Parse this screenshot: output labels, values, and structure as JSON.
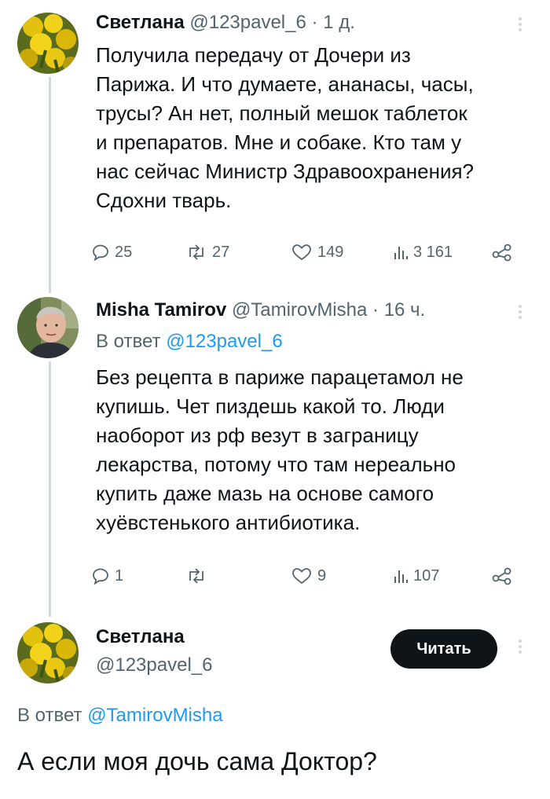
{
  "tweet1": {
    "author_name": "Светлана",
    "handle": "@123pavel_6",
    "separator": "·",
    "time": "1 д.",
    "text": "Получила передачу от Дочери из\nПарижа. И что думаете, ананасы, часы,\nтрусы? Ан нет, полный мешок таблеток\nи препаратов. Мне и собаке. Кто там у\nнас сейчас Министр Здравоохранения?\nСдохни тварь.",
    "replies": "25",
    "retweets": "27",
    "likes": "149",
    "views": "3 161"
  },
  "tweet2": {
    "author_name": "Misha Tamirov",
    "handle": "@TamirovMisha",
    "separator": "·",
    "time": "16 ч.",
    "reply_prefix": "В ответ",
    "reply_handle": "@123pavel_6",
    "text": "Без рецепта в париже парацетамол не\nкупишь. Чет пиздешь какой то. Люди\nнаоборот из рф везут в заграницу\nлекарства, потому что там нереально\nкупить даже мазь на основе самого\nхуёвстенького антибиотика.",
    "replies": "1",
    "retweets": "",
    "likes": "9",
    "views": "107"
  },
  "tweet3": {
    "author_name": "Светлана",
    "handle": "@123pavel_6",
    "read_button": "Читать",
    "reply_prefix": "В ответ",
    "reply_handle": "@TamirovMisha",
    "text": "А если моя дочь сама Доктор?"
  },
  "icons": {
    "reply": "comment-bubble-icon",
    "retweet": "retweet-icon",
    "like": "heart-icon",
    "views": "bar-chart-icon",
    "share": "share-icon",
    "more": "more-vertical-icon"
  },
  "colors": {
    "text": "#0f1419",
    "muted": "#536471",
    "link": "#1d9bf0",
    "thread_line": "#cfd9de",
    "button_bg": "#0f1419"
  }
}
